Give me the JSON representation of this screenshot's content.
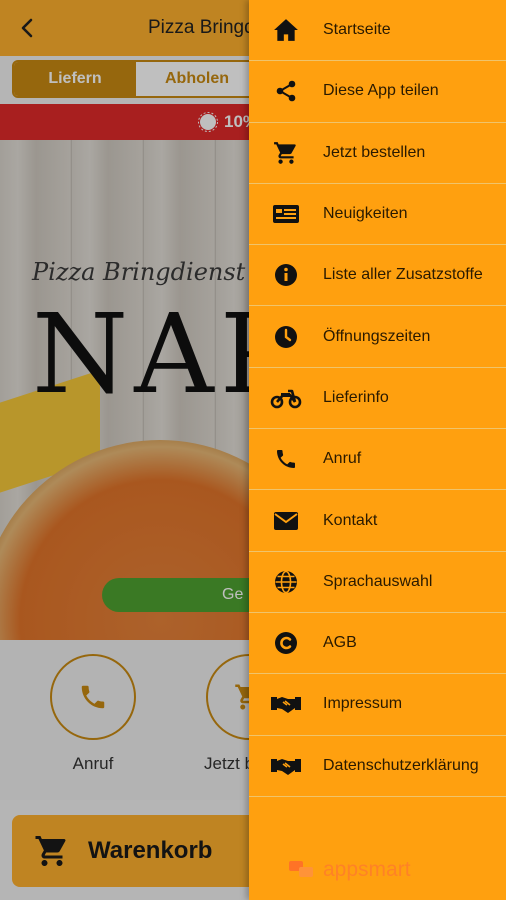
{
  "app": {
    "title": "Pizza Bringdienst Napoli",
    "tabs": [
      {
        "label": "Liefern",
        "active": true
      },
      {
        "label": "Abholen",
        "active": false
      }
    ],
    "promo_text": "10%",
    "hero": {
      "subtitle": "Pizza Bringdienst",
      "name": "NAPOLI",
      "green_button": "Ge"
    },
    "actions": [
      {
        "label": "Anruf",
        "icon": "phone-icon"
      },
      {
        "label": "Jetzt bestellen",
        "icon": "cart-icon"
      }
    ],
    "cart_button": "Warenkorb"
  },
  "drawer": {
    "items": [
      {
        "label": "Startseite",
        "icon": "home-icon"
      },
      {
        "label": "Diese App teilen",
        "icon": "share-icon"
      },
      {
        "label": "Jetzt bestellen",
        "icon": "cart-icon"
      },
      {
        "label": "Neuigkeiten",
        "icon": "news-icon"
      },
      {
        "label": "Liste aller Zusatzstoffe",
        "icon": "info-icon"
      },
      {
        "label": "Öffnungszeiten",
        "icon": "clock-icon"
      },
      {
        "label": "Lieferinfo",
        "icon": "motorcycle-icon"
      },
      {
        "label": "Anruf",
        "icon": "phone-icon"
      },
      {
        "label": "Kontakt",
        "icon": "mail-icon"
      },
      {
        "label": "Sprachauswahl",
        "icon": "globe-icon"
      },
      {
        "label": "AGB",
        "icon": "copyright-icon"
      },
      {
        "label": "Impressum",
        "icon": "handshake-icon"
      },
      {
        "label": "Datenschutzerklärung",
        "icon": "handshake-icon"
      }
    ],
    "brand": "appsmart"
  },
  "colors": {
    "drawer_bg": "#ffa00f",
    "topbar": "#ffb02e",
    "accent": "#c98a12",
    "promo": "#e02a2a"
  }
}
